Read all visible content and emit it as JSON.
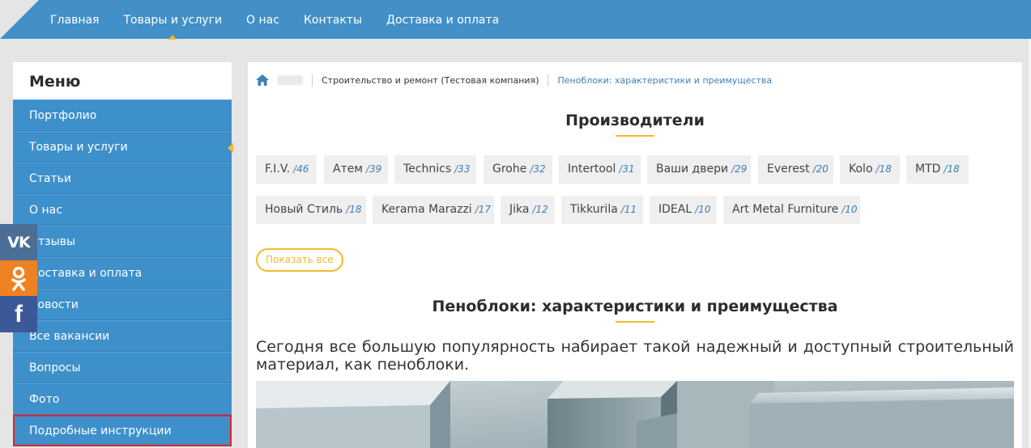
{
  "topnav": {
    "items": [
      {
        "label": "Главная",
        "active": false
      },
      {
        "label": "Товары и услуги",
        "active": true
      },
      {
        "label": "О нас",
        "active": false
      },
      {
        "label": "Контакты",
        "active": false
      },
      {
        "label": "Доставка и оплата",
        "active": false
      }
    ]
  },
  "sidebar": {
    "title": "Меню",
    "items": [
      {
        "label": "Портфолио"
      },
      {
        "label": "Товары и услуги"
      },
      {
        "label": "Статьи"
      },
      {
        "label": "О нас"
      },
      {
        "label": "Отзывы"
      },
      {
        "label": "Доставка и оплата"
      },
      {
        "label": "Новости"
      },
      {
        "label": "Все вакансии"
      },
      {
        "label": "Вопросы"
      },
      {
        "label": "Фото"
      },
      {
        "label": "Подробные инструкции"
      }
    ]
  },
  "social": {
    "vk": "VK",
    "ok": "OK",
    "fb": "f"
  },
  "breadcrumb": {
    "company": "Строительство и ремонт (Тестовая компания)",
    "current": "Пеноблоки: характеристики и преимущества"
  },
  "manufacturers": {
    "title": "Производители",
    "tags": [
      {
        "name": "F.I.V.",
        "count": "/46"
      },
      {
        "name": "Атем",
        "count": "/39"
      },
      {
        "name": "Technics",
        "count": "/33"
      },
      {
        "name": "Grohe",
        "count": "/32"
      },
      {
        "name": "Intertool",
        "count": "/31"
      },
      {
        "name": "Ваши двери",
        "count": "/29"
      },
      {
        "name": "Everest",
        "count": "/20"
      },
      {
        "name": "Kolo",
        "count": "/18"
      },
      {
        "name": "MTD",
        "count": "/18"
      },
      {
        "name": "Новый Стиль",
        "count": "/18"
      },
      {
        "name": "Kerama Marazzi",
        "count": "/17"
      },
      {
        "name": "Jika",
        "count": "/12"
      },
      {
        "name": "Tikkurila",
        "count": "/11"
      },
      {
        "name": "IDEAL",
        "count": "/10"
      },
      {
        "name": "Art Metal Furniture",
        "count": "/10"
      }
    ],
    "show_all": "Показать все"
  },
  "article": {
    "title": "Пеноблоки: характеристики и преимущества",
    "text": "Сегодня все большую популярность набирает такой надежный и доступный строительный материал, как пеноблоки."
  },
  "colors": {
    "nav_blue": "#4390c8",
    "menu_blue": "#3e90cb",
    "accent_yellow": "#f2ba2c",
    "link_blue": "#3e7fb8",
    "highlight_red": "#e2222b",
    "vk": "#4b6e96",
    "ok": "#ef8122",
    "fb": "#3b5998"
  }
}
